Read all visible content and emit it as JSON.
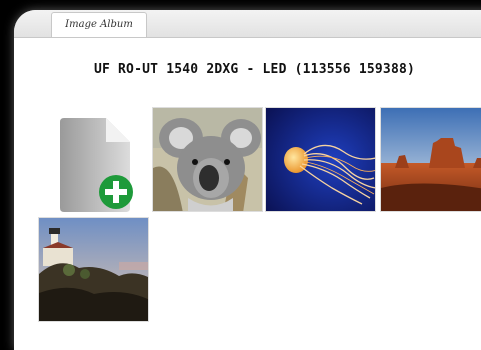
{
  "tabs": [
    {
      "label": "Image Album",
      "active": true
    }
  ],
  "album": {
    "title": "UF RO-UT 1540 2DXG - LED (113556 159388)",
    "add_tile": {
      "icon": "add-file-icon"
    },
    "images": [
      {
        "subject": "koala",
        "icon": "koala-photo"
      },
      {
        "subject": "jellyfish",
        "icon": "jellyfish-photo"
      },
      {
        "subject": "desert",
        "icon": "desert-photo"
      },
      {
        "subject": "lighthouse",
        "icon": "lighthouse-photo"
      }
    ]
  },
  "colors": {
    "plus_green": "#1e9a3a",
    "page_bg": "#000000"
  }
}
